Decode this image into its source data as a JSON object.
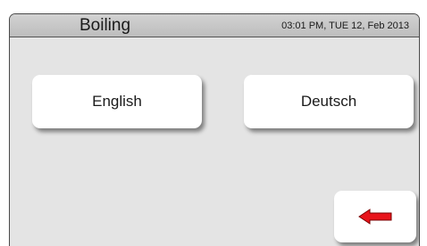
{
  "header": {
    "title": "Boiling",
    "datetime": "03:01 PM, TUE 12, Feb 2013"
  },
  "languages": [
    {
      "label": "English"
    },
    {
      "label": "Deutsch"
    }
  ],
  "back_button": {
    "icon": "left-arrow-icon",
    "icon_color": "#e8141b"
  },
  "colors": {
    "background": "#e4e4e4",
    "titlebar": "#c8c8c8",
    "button": "#ffffff"
  }
}
